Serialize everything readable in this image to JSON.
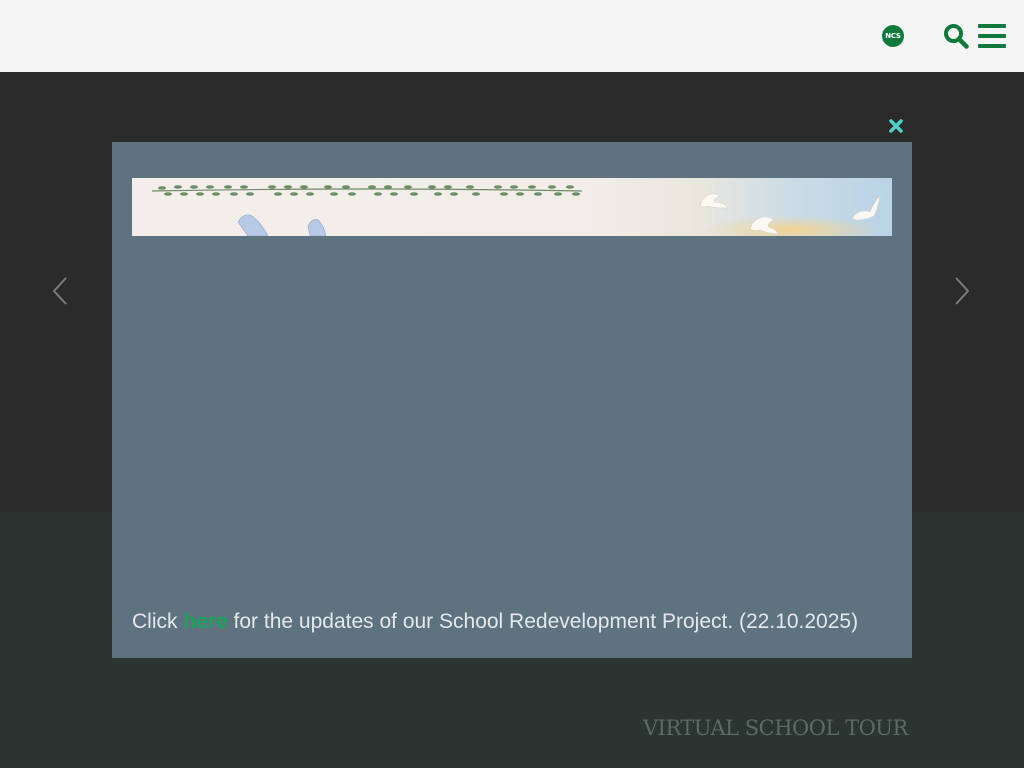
{
  "header": {
    "logo_badge": "NCS",
    "search_icon": "search-icon",
    "menu_icon": "hamburger-menu-icon"
  },
  "hero": {
    "prev_icon": "chevron-left-icon",
    "next_icon": "chevron-right-icon"
  },
  "modal": {
    "close_icon": "close-icon",
    "banner_icon": "peace-doves-banner",
    "text_before": "Click ",
    "link_text": "here",
    "text_after": " for the updates of our School Redevelopment Project. (22.10.2025)"
  },
  "lower": {
    "virtual_tour_label": "VIRTUAL SCHOOL TOUR"
  },
  "colors": {
    "brand_green": "#0f7a3c",
    "link_green": "#19a35a",
    "close_cyan": "#4fd0c8",
    "modal_bg": "#5e7280"
  }
}
